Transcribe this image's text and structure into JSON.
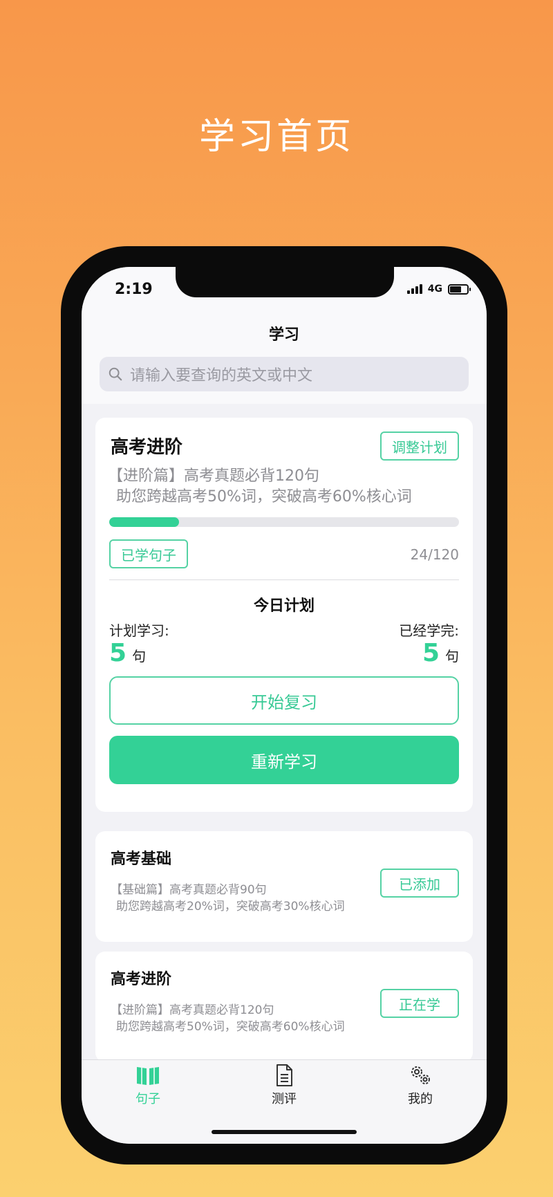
{
  "promo": {
    "title": "学习首页"
  },
  "status": {
    "time": "2:19",
    "network": "4G"
  },
  "nav": {
    "title": "学习"
  },
  "search": {
    "placeholder": "请输入要查询的英文或中文"
  },
  "current_course": {
    "title": "高考进阶",
    "adjust_label": "调整计划",
    "desc_line1": "【进阶篇】高考真题必背120句",
    "desc_line2": "助您跨越高考50%词，突破高考60%核心词",
    "progress_fraction": 0.2,
    "learned_label": "已学句子",
    "count": "24/120"
  },
  "today_plan": {
    "title": "今日计划",
    "plan_label": "计划学习:",
    "plan_value": "5",
    "plan_unit": "句",
    "done_label": "已经学完:",
    "done_value": "5",
    "done_unit": "句",
    "review_label": "开始复习",
    "relearn_label": "重新学习"
  },
  "courses": [
    {
      "title": "高考基础",
      "desc_line1": "【基础篇】高考真题必背90句",
      "desc_line2": "助您跨越高考20%词，突破高考30%核心词",
      "button_label": "已添加"
    },
    {
      "title": "高考进阶",
      "desc_line1": "【进阶篇】高考真题必背120句",
      "desc_line2": "助您跨越高考50%词，突破高考60%核心词",
      "button_label": "正在学"
    }
  ],
  "tabs": [
    {
      "label": "句子",
      "icon": "book-icon",
      "active": true
    },
    {
      "label": "测评",
      "icon": "document-icon",
      "active": false
    },
    {
      "label": "我的",
      "icon": "gear-icon",
      "active": false
    }
  ],
  "colors": {
    "accent": "#33d196",
    "promo_top": "#f8974a",
    "promo_bottom": "#fbd06f"
  }
}
